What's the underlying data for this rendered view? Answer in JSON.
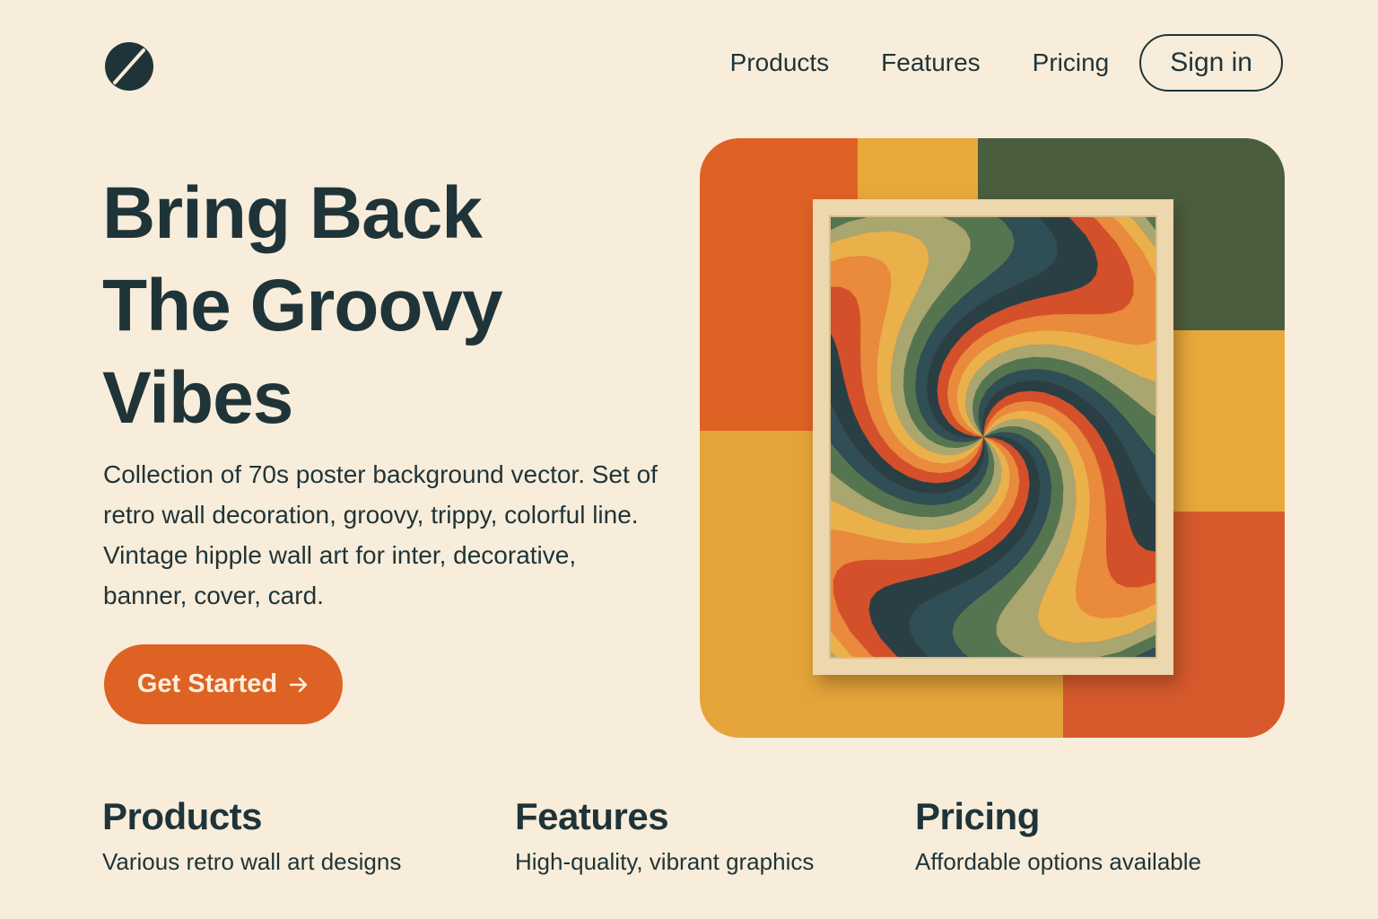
{
  "brand": {
    "logo_icon": "slashed-circle-logo-icon"
  },
  "nav": {
    "items": [
      {
        "label": "Products"
      },
      {
        "label": "Features"
      },
      {
        "label": "Pricing"
      }
    ],
    "signin_label": "Sign in"
  },
  "hero": {
    "title_lines": [
      "Bring Back",
      "The Groovy",
      "Vibes"
    ],
    "description": "Collection of 70s poster background vector. Set of retro wall decoration, groovy, trippy, colorful line. Vintage hipple wall art for inter, decorative, banner, cover, card.",
    "cta_label": "Get Started",
    "cta_icon": "arrow-right-icon"
  },
  "artwork": {
    "block_colors": [
      "#dd6224",
      "#e8a93a",
      "#4a5e3f",
      "#e4a43a",
      "#d65a2c"
    ],
    "swirl_colors": [
      "#d4502a",
      "#e98a3c",
      "#eab04a",
      "#a9a670",
      "#557550",
      "#2f4e55",
      "#2a3f44"
    ]
  },
  "features": [
    {
      "title": "Products",
      "text": "Various retro wall art designs"
    },
    {
      "title": "Features",
      "text": "High-quality, vibrant graphics"
    },
    {
      "title": "Pricing",
      "text": "Affordable options available"
    }
  ],
  "colors": {
    "background": "#f8edda",
    "text": "#1f3439",
    "accent": "#dd6224"
  }
}
